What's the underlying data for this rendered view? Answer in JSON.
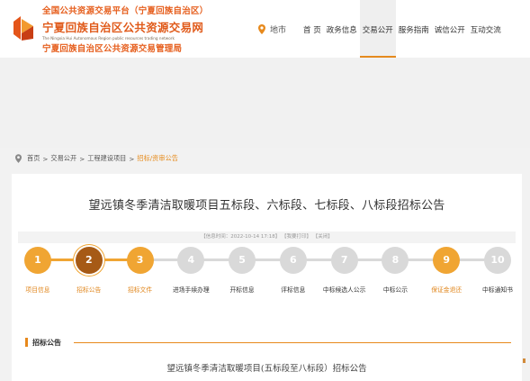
{
  "header": {
    "logo_line1": "全国公共资源交易平台（宁夏回族自治区）",
    "logo_line2": "宁夏回族自治区公共资源交易网",
    "logo_line3": "The Ningxia Hui Autonomous Region public resources trading network",
    "logo_line4": "宁夏回族自治区公共资源交易管理局",
    "city_label": "地市",
    "nav": [
      {
        "label": "首 页",
        "active": false
      },
      {
        "label": "政务信息",
        "active": false
      },
      {
        "label": "交易公开",
        "active": true
      },
      {
        "label": "服务指南",
        "active": false
      },
      {
        "label": "诚信公开",
        "active": false
      },
      {
        "label": "互动交流",
        "active": false
      }
    ]
  },
  "breadcrumb": {
    "items": [
      "首页",
      "交易公开",
      "工程建设项目",
      "招标/资审公告"
    ],
    "separator": ">"
  },
  "article": {
    "title": "望远镇冬季清洁取暖项目五标段、六标段、七标段、八标段招标公告",
    "info_time_label": "【信息时间：2022-10-14 17:18】",
    "print_label": "【我要打印】",
    "close_label": "【关闭】",
    "section_title": "招标公告",
    "notice_title": "望远镇冬季清洁取暖项目(五标段至八标段）招标公告"
  },
  "steps": [
    {
      "num": "1",
      "label": "项目信息",
      "state": "done"
    },
    {
      "num": "2",
      "label": "招标公告",
      "state": "current"
    },
    {
      "num": "3",
      "label": "招标文件",
      "state": "done"
    },
    {
      "num": "4",
      "label": "进场手续办理",
      "state": "todo"
    },
    {
      "num": "5",
      "label": "开标信息",
      "state": "todo"
    },
    {
      "num": "6",
      "label": "评标信息",
      "state": "todo"
    },
    {
      "num": "7",
      "label": "中标候选人公示",
      "state": "todo"
    },
    {
      "num": "8",
      "label": "中标公示",
      "state": "todo"
    },
    {
      "num": "9",
      "label": "保证金退还",
      "state": "done"
    },
    {
      "num": "10",
      "label": "中标通知书",
      "state": "todo"
    }
  ],
  "colors": {
    "done": "#f0a533",
    "current": "#a65a16",
    "todo": "#d9d9d9",
    "accent": "#e7891c",
    "done_label": "#e0861c",
    "todo_label": "#333333"
  }
}
